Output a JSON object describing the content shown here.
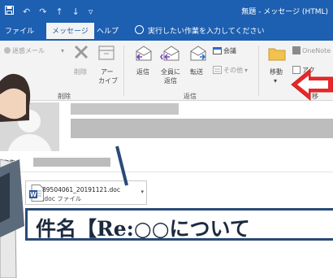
{
  "window": {
    "title": "無題 - メッセージ (HTML)",
    "qat": [
      "save-icon",
      "undo-icon",
      "redo-icon",
      "up-icon",
      "down-icon",
      "customize-icon"
    ]
  },
  "tabs": {
    "file": "ファイル",
    "message": "メッセージ",
    "help": "ヘルプ",
    "tell_me": "実行したい作業を入力してください"
  },
  "ribbon": {
    "delete_group": {
      "junk": "迷惑メール",
      "delete": "削除",
      "archive_l1": "アー",
      "archive_l2": "カイブ",
      "label": "削除"
    },
    "respond_group": {
      "reply": "返信",
      "reply_all_l1": "全員に",
      "reply_all_l2": "返信",
      "forward": "転送",
      "meeting": "会議",
      "more": "その他",
      "label": "返信"
    },
    "move_group": {
      "move": "移動",
      "onenote": "OneNote",
      "actions": "アク",
      "label": "移"
    }
  },
  "message": {
    "to_label": "宛先"
  },
  "attachment": {
    "filename": "89504061_20191121.doc",
    "type": ".doc ファイル"
  },
  "overlay": {
    "subject": "件名【Re:○○について"
  },
  "colors": {
    "accent": "#1d5fb0",
    "overlay_border": "#2a4a78",
    "arrow": "#e6282a"
  }
}
